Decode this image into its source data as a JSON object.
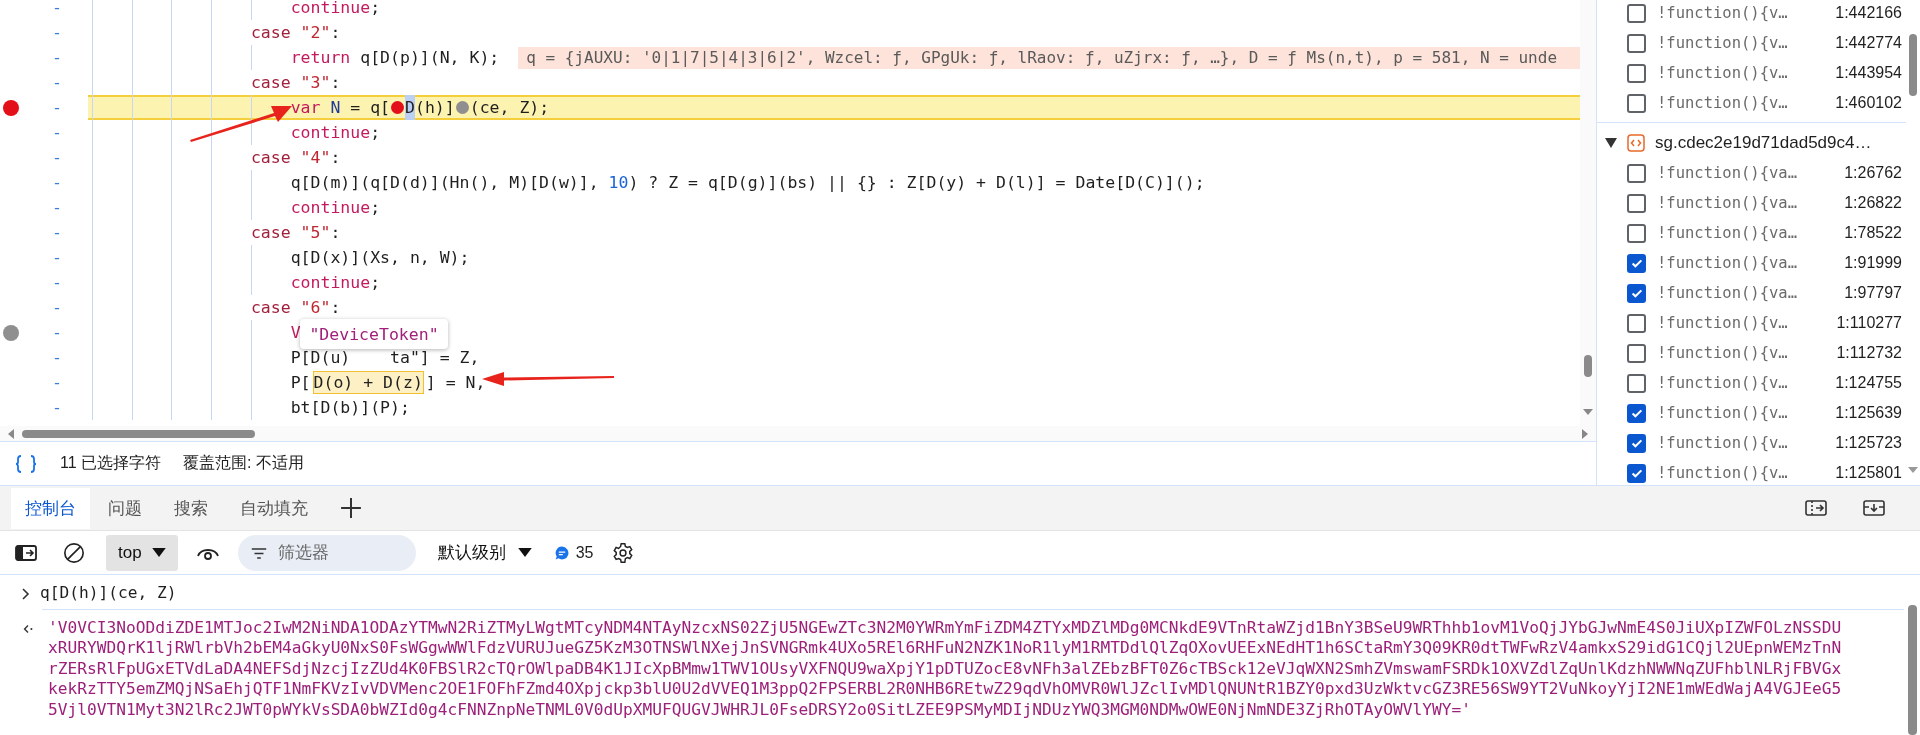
{
  "editor": {
    "lines": [
      {
        "number": "-",
        "breakpoint": false,
        "paused": false,
        "tokens": [
          {
            "kind": "flow",
            "text": "                    continue"
          },
          {
            "kind": "plain",
            "text": ";"
          }
        ]
      },
      {
        "number": "-",
        "breakpoint": false,
        "paused": false,
        "tokens": [
          {
            "kind": "kw",
            "text": "                case"
          },
          {
            "kind": "str",
            "text": " \"2\""
          },
          {
            "kind": "plain",
            "text": ":"
          }
        ]
      },
      {
        "number": "-",
        "breakpoint": false,
        "paused": false,
        "tokens": [
          {
            "kind": "flow",
            "text": "                    return"
          },
          {
            "kind": "plain",
            "text": " q[D(p)](N, K);"
          }
        ],
        "inline_value": "q = {jAUXU: '0|1|7|5|4|3|6|2', Wzcel: ƒ, GPgUk: ƒ, lRaov: ƒ, uZjrx: ƒ, …}, D = ƒ Ms(n,t), p = 581, N = unde"
      },
      {
        "number": "-",
        "breakpoint": false,
        "paused": false,
        "tokens": [
          {
            "kind": "kw",
            "text": "                case"
          },
          {
            "kind": "str",
            "text": " \"3\""
          },
          {
            "kind": "plain",
            "text": ":"
          }
        ]
      },
      {
        "number": "-",
        "breakpoint": true,
        "breakpoint_disabled": false,
        "paused": true,
        "tokens": [
          {
            "kind": "flow",
            "text": "                    var"
          },
          {
            "kind": "def",
            "text": " N"
          },
          {
            "kind": "plain",
            "text": " = q["
          },
          {
            "kind": "bp_active"
          },
          {
            "kind": "sel",
            "text": "D"
          },
          {
            "kind": "plain",
            "text": "(h)]"
          },
          {
            "kind": "bp_inactive"
          },
          {
            "kind": "plain",
            "text": "(ce, Z);"
          }
        ]
      },
      {
        "number": "-",
        "breakpoint": false,
        "paused": false,
        "tokens": [
          {
            "kind": "flow",
            "text": "                    continue"
          },
          {
            "kind": "plain",
            "text": ";"
          }
        ]
      },
      {
        "number": "-",
        "breakpoint": false,
        "paused": false,
        "tokens": [
          {
            "kind": "kw",
            "text": "                case"
          },
          {
            "kind": "str",
            "text": " \"4\""
          },
          {
            "kind": "plain",
            "text": ":"
          }
        ]
      },
      {
        "number": "-",
        "breakpoint": false,
        "paused": false,
        "tokens": [
          {
            "kind": "plain",
            "text": "                    q[D(m)](q[D(d)](Hn(), M)[D(w)], "
          },
          {
            "kind": "num",
            "text": "10"
          },
          {
            "kind": "plain",
            "text": ") ? Z = q[D(g)](bs) || {} : Z[D(y) + D(l)] = Date[D(C)]();"
          }
        ]
      },
      {
        "number": "-",
        "breakpoint": false,
        "paused": false,
        "tokens": [
          {
            "kind": "flow",
            "text": "                    continue"
          },
          {
            "kind": "plain",
            "text": ";"
          }
        ]
      },
      {
        "number": "-",
        "breakpoint": false,
        "paused": false,
        "tokens": [
          {
            "kind": "kw",
            "text": "                case"
          },
          {
            "kind": "str",
            "text": " \"5\""
          },
          {
            "kind": "plain",
            "text": ":"
          }
        ]
      },
      {
        "number": "-",
        "breakpoint": false,
        "paused": false,
        "tokens": [
          {
            "kind": "plain",
            "text": "                    q[D(x)](Xs, n, W);"
          }
        ]
      },
      {
        "number": "-",
        "breakpoint": false,
        "paused": false,
        "tokens": [
          {
            "kind": "flow",
            "text": "                    continue"
          },
          {
            "kind": "plain",
            "text": ";"
          }
        ]
      },
      {
        "number": "-",
        "breakpoint": false,
        "paused": false,
        "tokens": [
          {
            "kind": "kw",
            "text": "                case"
          },
          {
            "kind": "str",
            "text": " \"6\""
          },
          {
            "kind": "plain",
            "text": ":"
          }
        ]
      },
      {
        "number": "-",
        "breakpoint": true,
        "breakpoint_disabled": true,
        "paused": false,
        "tokens": [
          {
            "kind": "flow",
            "text": "                    V"
          }
        ]
      },
      {
        "number": "-",
        "breakpoint": false,
        "paused": false,
        "tokens": [
          {
            "kind": "plain",
            "text": "                    P[D(u)    ta\"] = Z,"
          }
        ]
      },
      {
        "number": "-",
        "breakpoint": false,
        "paused": false,
        "tokens": [
          {
            "kind": "plain",
            "text": "                    P["
          },
          {
            "kind": "hover",
            "text": "D(o) + D(z)"
          },
          {
            "kind": "plain",
            "text": "] = N,"
          }
        ]
      },
      {
        "number": "-",
        "breakpoint": false,
        "paused": false,
        "tokens": [
          {
            "kind": "plain",
            "text": "                    bt[D(b)](P);"
          }
        ]
      }
    ],
    "tooltip": {
      "text": "\"DeviceToken\""
    }
  },
  "status_bar": {
    "selection": "11 已选择字符",
    "coverage": "覆盖范围: 不适用"
  },
  "breakpoint_panel": {
    "rows": [
      {
        "code": "!function(){v…",
        "location": "1:442166",
        "checked": false
      },
      {
        "code": "!function(){v…",
        "location": "1:442774",
        "checked": false
      },
      {
        "code": "!function(){v…",
        "location": "1:443954",
        "checked": false
      },
      {
        "code": "!function(){v…",
        "location": "1:460102",
        "checked": false
      }
    ],
    "file_group": {
      "name": "sg.cdec2e19d71dad5d9c4…",
      "expanded": true,
      "rows": [
        {
          "code": "!function(){va…",
          "location": "1:26762",
          "checked": false
        },
        {
          "code": "!function(){va…",
          "location": "1:26822",
          "checked": false
        },
        {
          "code": "!function(){va…",
          "location": "1:78522",
          "checked": false
        },
        {
          "code": "!function(){va…",
          "location": "1:91999",
          "checked": true
        },
        {
          "code": "!function(){va…",
          "location": "1:97797",
          "checked": true
        },
        {
          "code": "!function(){v…",
          "location": "1:110277",
          "checked": false
        },
        {
          "code": "!function(){v…",
          "location": "1:112732",
          "checked": false
        },
        {
          "code": "!function(){v…",
          "location": "1:124755",
          "checked": false
        },
        {
          "code": "!function(){v…",
          "location": "1:125639",
          "checked": true
        },
        {
          "code": "!function(){v…",
          "location": "1:125723",
          "checked": true
        },
        {
          "code": "!function(){v…",
          "location": "1:125801",
          "checked": true
        }
      ]
    }
  },
  "drawer": {
    "tabs": [
      {
        "label": "控制台",
        "selected": true
      },
      {
        "label": "问题",
        "selected": false
      },
      {
        "label": "搜索",
        "selected": false
      },
      {
        "label": "自动填充",
        "selected": false
      }
    ]
  },
  "console_toolbar": {
    "context": "top",
    "filter": {
      "placeholder": "筛选器"
    },
    "log_level": "默认级别",
    "message_count": "35"
  },
  "console": {
    "input": "q[D(h)](ce, Z)",
    "result": "'V0VCI3NoODdiZDE1MTJoc2IwM2NiNDA1ODAzYTMwN2RiZTMyLWgtMTcyNDM4NTAyNzcxNS02ZjU5NGEwZTc3N2M0YWRmYmFiZDM4ZTYxMDZlMDg0MCNkdE9VTnRtaWZjd1BnY3BSeU9WRThhb1ovM1VoQjJYbGJwNmE4S0JiUXpIZWFOLzNSSDUxRURYWDQrK1ljRWlrbVh2bEM4aGkyU0NxS0FsWGgwWWlFdzVURUJueGZ5KzM3OTNSWlNXejJnSVNGRmk4UXo5REl6RHFuN2NZK1NoR1lyM1RMTDdlQlZqOXovUEExNEdHT1h6SCtaRmY3Q09KR0dtTWFwRzV4amkxS29idG1CQjl2UEpnWEMzTnNrZERsRlFpUGxETVdLaDA4NEFSdjNzcjIzZUd4K0FBSlR2cTQrOWlpaDB4K1JIcXpBMmw1TWV1OUsyVXFNQU9waXpjY1pDTUZocE8vNFh3alZEbzBFT0Z6cTBSck12eVJqWXN2SmhZVmswamFSRDk1OXVZdlZqUnlKdzhNWWNqZUFhblNLRjFBVGxkekRzTTY5emZMQjNSaEhjQTF1NmFKVzIvVDVMenc2OE1FOFhFZmd4OXpjckp3blU0U2dVVEQ1M3ppQ2FPSERBL2R0NHB6REtwZ29qdVhOMVR0WlJZclIvMDlQNUNtR1BZY0pxd3UzWktvcGZ3RE56SW9YT2VuNkoyYjI2NE1mWEdWajA4VGJEeG55Vjl0VTN1Myt3N2lRc2JWT0pWYkVsSDA0bWZId0g4cFNNZnpNeTNML0V0dUpXMUFQUGVJWHRJL0FseDRSY2o0SitLZEE9PSMyMDIjNDUzYWQ3MGM0NDMwOWE0NjNmNDE3ZjRhOTAyOWVlYWY='"
  }
}
